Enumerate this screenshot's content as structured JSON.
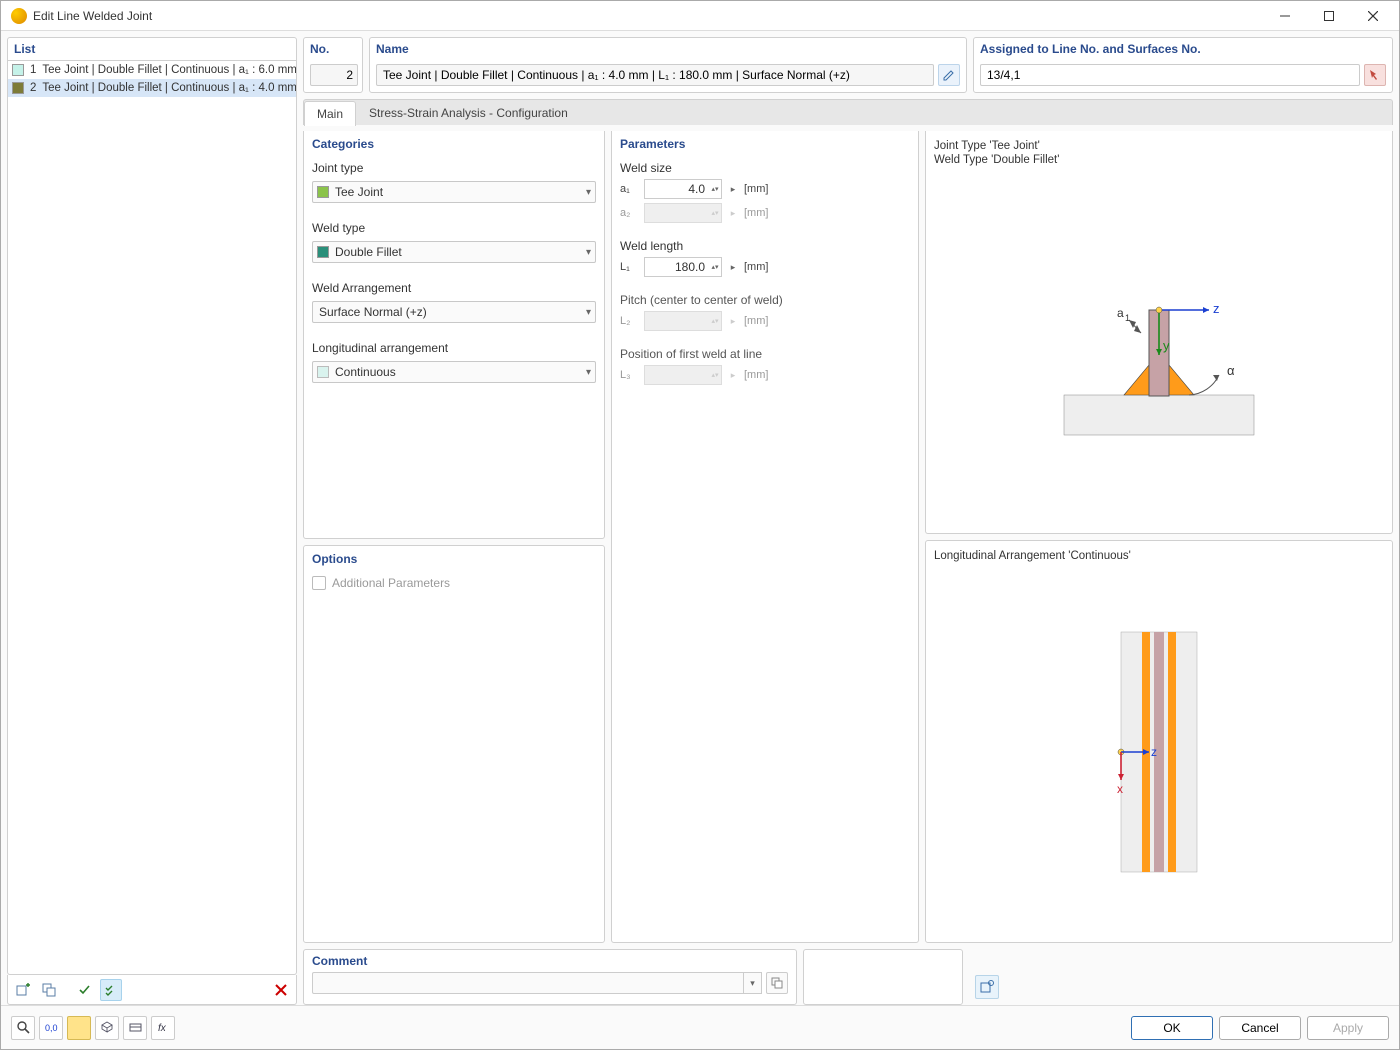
{
  "title": "Edit Line Welded Joint",
  "left": {
    "header": "List",
    "items": [
      {
        "num": "1",
        "label": "Tee Joint | Double Fillet | Continuous | a₁ : 6.0 mm",
        "selected": false
      },
      {
        "num": "2",
        "label": "Tee Joint | Double Fillet | Continuous | a₁ : 4.0 mm",
        "selected": true
      }
    ]
  },
  "top": {
    "no_label": "No.",
    "no_value": "2",
    "name_label": "Name",
    "name_value": "Tee Joint | Double Fillet | Continuous | a₁ : 4.0 mm | L₁ : 180.0 mm | Surface Normal (+z)",
    "assigned_label": "Assigned to Line No. and Surfaces No.",
    "assigned_value": "13/4,1"
  },
  "tabs": {
    "main": "Main",
    "stress": "Stress-Strain Analysis - Configuration"
  },
  "categories": {
    "title": "Categories",
    "joint_type_label": "Joint type",
    "joint_type_value": "Tee Joint",
    "weld_type_label": "Weld type",
    "weld_type_value": "Double Fillet",
    "arrangement_label": "Weld Arrangement",
    "arrangement_value": "Surface Normal (+z)",
    "long_label": "Longitudinal arrangement",
    "long_value": "Continuous"
  },
  "options": {
    "title": "Options",
    "additional": "Additional Parameters"
  },
  "parameters": {
    "title": "Parameters",
    "weld_size": "Weld size",
    "a1": "a₁",
    "a1_val": "4.0",
    "a2": "a₂",
    "a2_val": "",
    "weld_length": "Weld length",
    "L1": "L₁",
    "L1_val": "180.0",
    "pitch": "Pitch (center to center of weld)",
    "L2": "L₂",
    "L2_val": "",
    "pos_first": "Position of first weld at line",
    "L3": "L₃",
    "L3_val": "",
    "unit_mm": "[mm]"
  },
  "preview": {
    "top_caption1": "Joint Type 'Tee Joint'",
    "top_caption2": "Weld Type 'Double Fillet'",
    "bottom_caption": "Longitudinal Arrangement 'Continuous'"
  },
  "comment": {
    "title": "Comment"
  },
  "buttons": {
    "ok": "OK",
    "cancel": "Cancel",
    "apply": "Apply"
  }
}
